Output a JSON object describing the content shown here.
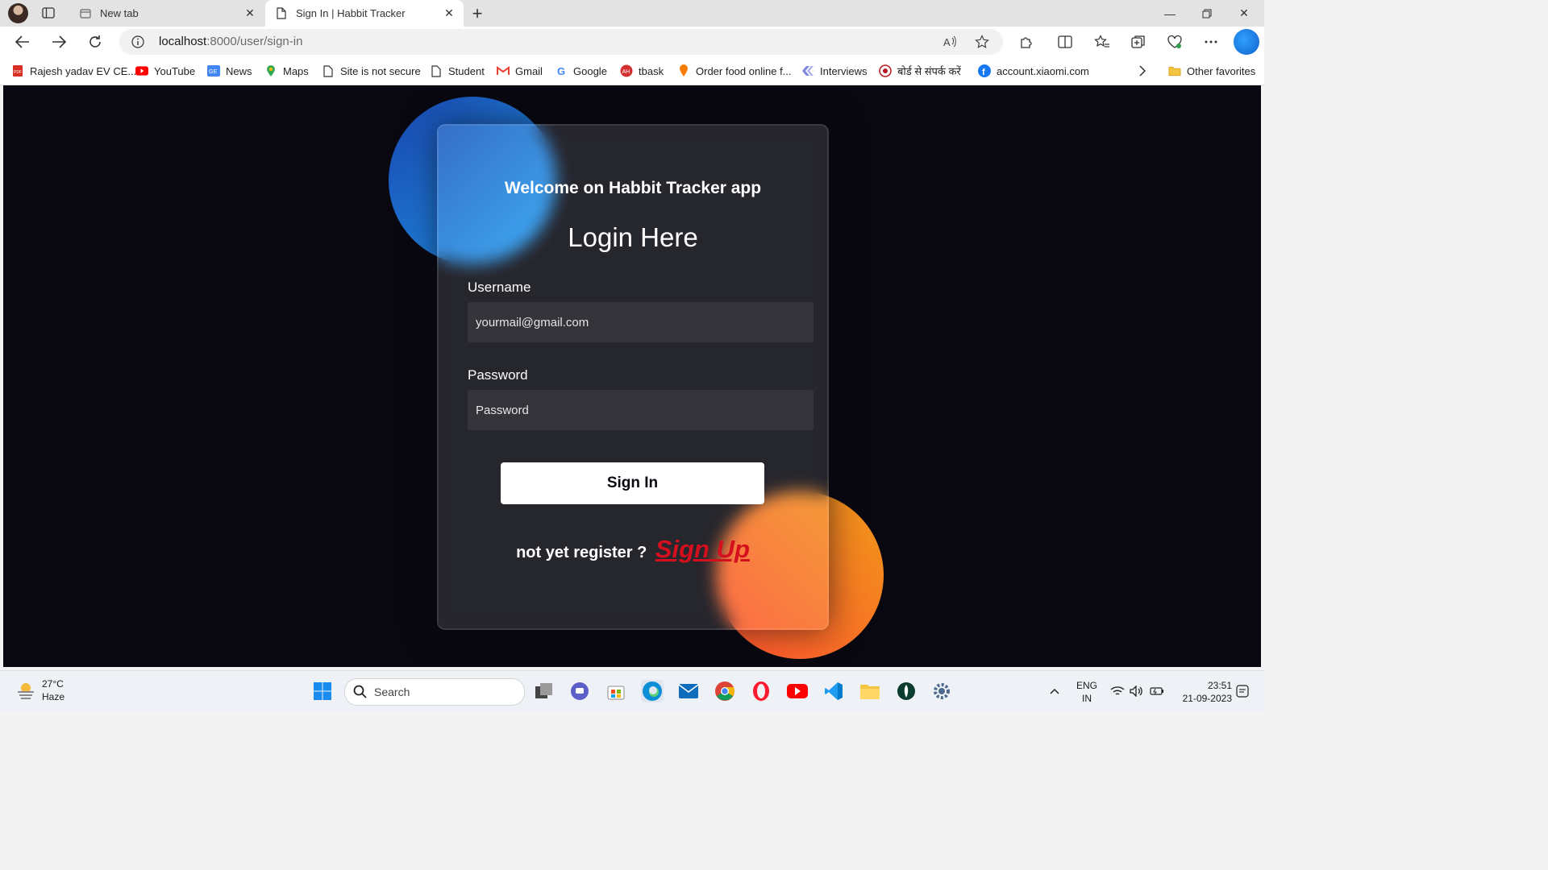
{
  "browser": {
    "tabs": [
      {
        "title": "New tab",
        "active": false
      },
      {
        "title": "Sign In | Habbit Tracker",
        "active": true
      }
    ],
    "address": {
      "host": "localhost",
      "rest": ":8000/user/sign-in"
    },
    "favorites": [
      {
        "label": "Rajesh yadav EV CE...",
        "icon": "pdf-icon"
      },
      {
        "label": "YouTube",
        "icon": "youtube-icon"
      },
      {
        "label": "News",
        "icon": "news-icon"
      },
      {
        "label": "Maps",
        "icon": "maps-icon"
      },
      {
        "label": "Site is not secure",
        "icon": "page-icon"
      },
      {
        "label": "Student",
        "icon": "page-icon"
      },
      {
        "label": "Gmail",
        "icon": "gmail-icon"
      },
      {
        "label": "Google",
        "icon": "google-icon"
      },
      {
        "label": "tbask",
        "icon": "tbask-icon"
      },
      {
        "label": "Order food online f...",
        "icon": "food-icon"
      },
      {
        "label": "Interviews",
        "icon": "interviews-icon"
      },
      {
        "label": "बोर्ड से संपर्क करें",
        "icon": "emblem-icon"
      },
      {
        "label": "account.xiaomi.com",
        "icon": "facebook-icon"
      }
    ],
    "other_favorites": "Other favorites"
  },
  "login": {
    "welcome": "Welcome on Habbit Tracker app",
    "title": "Login Here",
    "username_label": "Username",
    "username_placeholder": "yourmail@gmail.com",
    "password_label": "Password",
    "password_placeholder": "Password",
    "submit_label": "Sign In",
    "register_text": "not yet register ?",
    "signup_link": "Sign Up"
  },
  "colors": {
    "page_bg": "#090810",
    "blob_blue": "#1845ad",
    "blob_orange": "#ff512f",
    "signup_red": "#d4101e"
  },
  "taskbar": {
    "weather_temp": "27°C",
    "weather_desc": "Haze",
    "search_placeholder": "Search",
    "lang_top": "ENG",
    "lang_bottom": "IN",
    "time": "23:51",
    "date": "21-09-2023"
  }
}
